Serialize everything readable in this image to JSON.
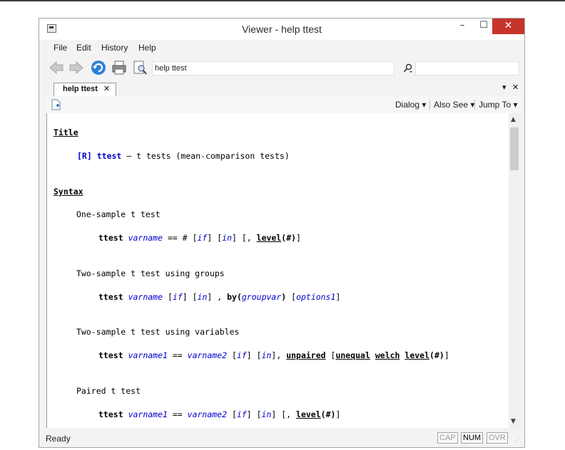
{
  "window": {
    "title": "Viewer - help ttest",
    "minimize": "–",
    "maximize": "☐",
    "close": "✕"
  },
  "menu": [
    "File",
    "Edit",
    "History",
    "Help"
  ],
  "toolbar": {
    "address_value": "help ttest",
    "search_value": ""
  },
  "tab": {
    "label": "help ttest",
    "close": "✕",
    "dropdown": "▾",
    "close_pane": "✕"
  },
  "viewer_toolbar": {
    "dialog": "Dialog ▾",
    "also_see": "Also See ▾",
    "jump_to": "Jump To ▾"
  },
  "doc": {
    "title_heading": "Title",
    "title_ref": "[R]",
    "title_cmd": "ttest",
    "title_desc": " — t tests (mean-comparison tests)",
    "syntax_heading": "Syntax",
    "s1_head": "One-sample t test",
    "s2_head": "Two-sample t test using groups",
    "s3_head": "Two-sample t test using variables",
    "s4_head": "Paired t test",
    "cmd": "ttest",
    "varname": "varname",
    "varname1": "varname1",
    "varname2": "varname2",
    "if": "if",
    "in": "in",
    "groupvar": "groupvar",
    "options1": "options1",
    "eq_hash": " == # ",
    "eq": " == ",
    "level": "level",
    "level_arg": "(#)",
    "by": "by(",
    "unpaired": "unpaired",
    "unequal": "unequal",
    "welch": "welch"
  },
  "status": {
    "text": "Ready",
    "cap": "CAP",
    "num": "NUM",
    "ovr": "OVR"
  }
}
